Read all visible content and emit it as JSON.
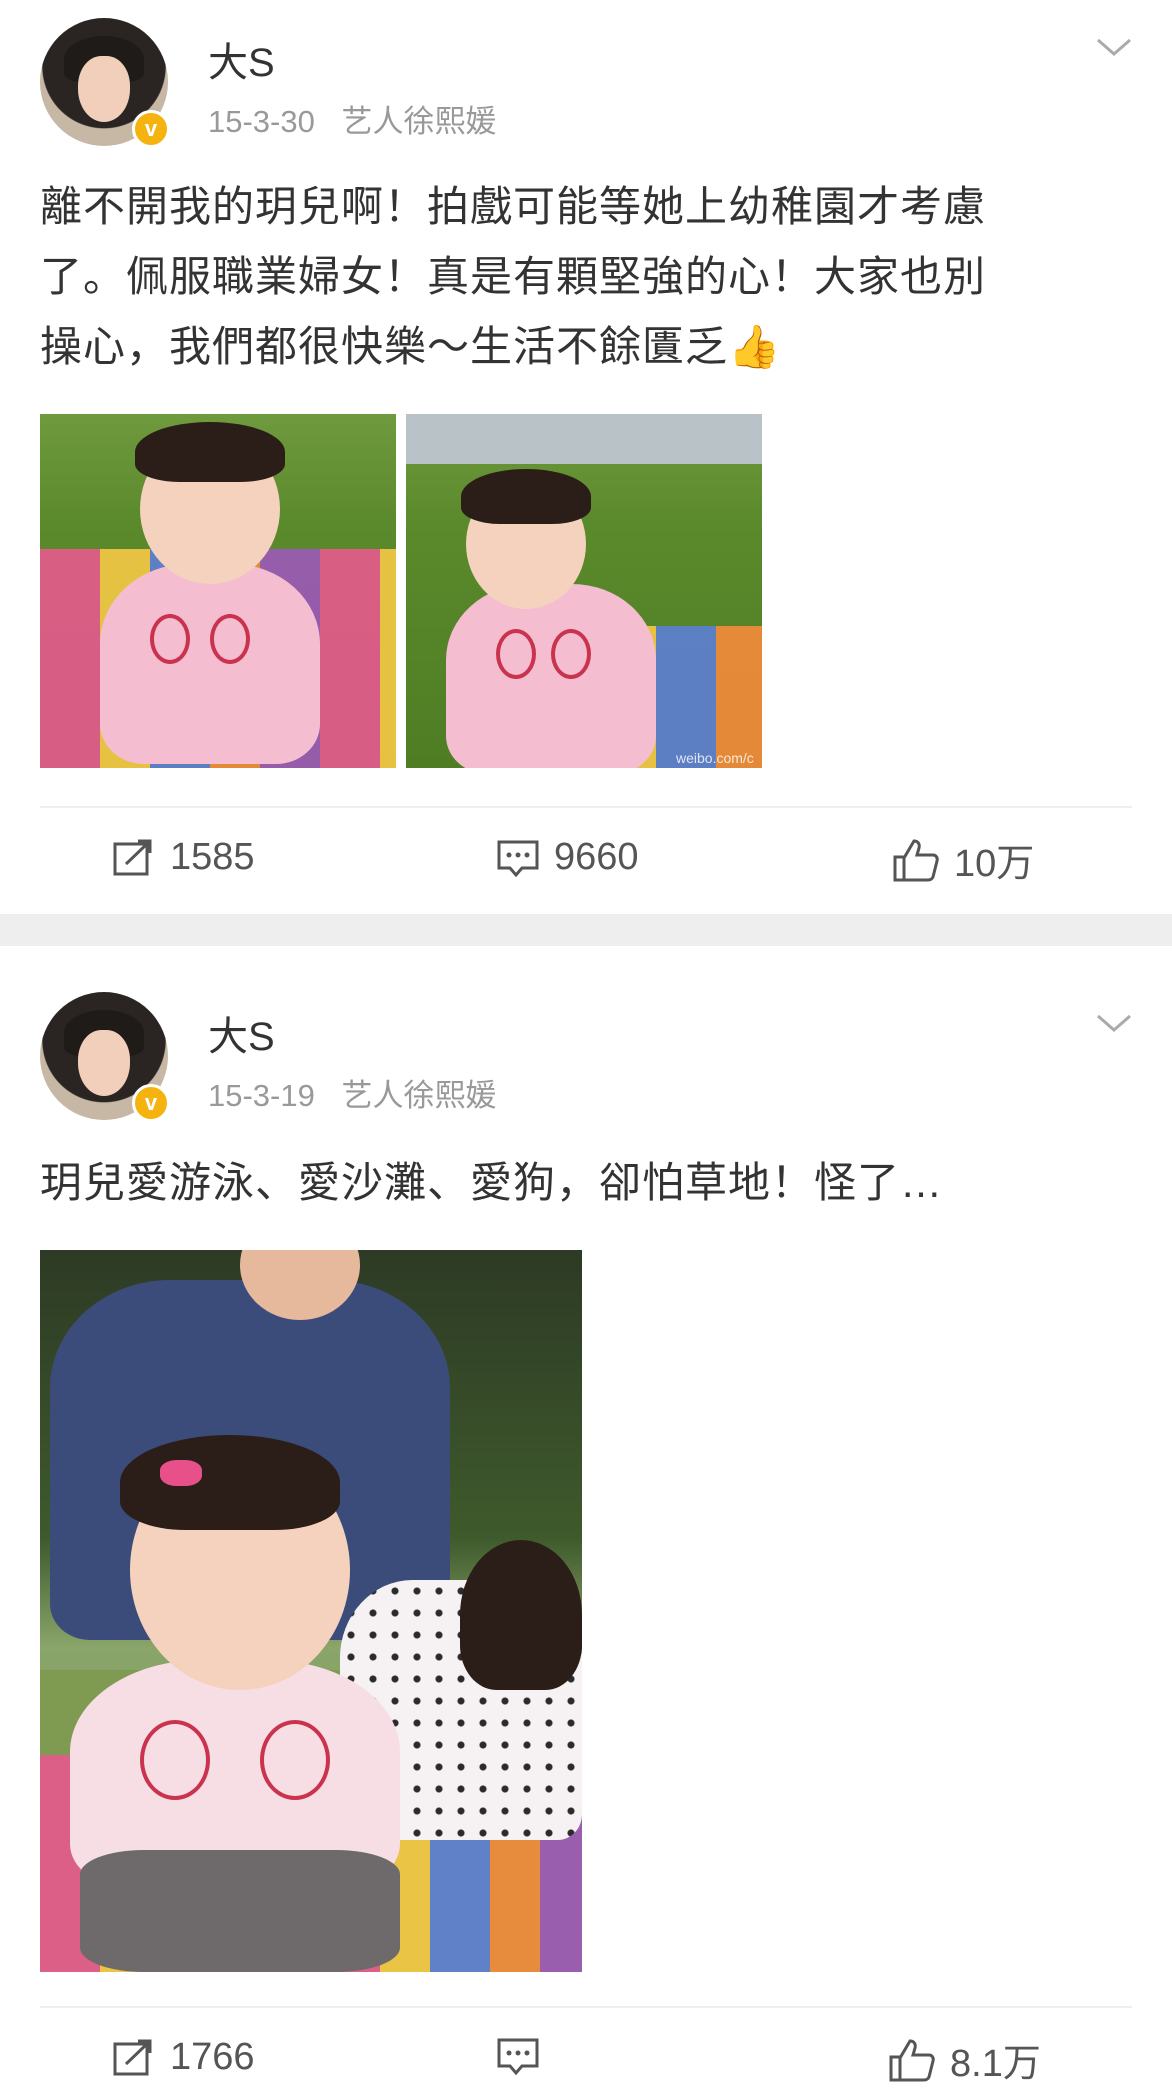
{
  "posts": [
    {
      "username": "大S",
      "date": "15-3-30",
      "source": "艺人徐熙媛",
      "text_lines": [
        "離不開我的玥兒啊！拍戲可能等她上幼稚園才考慮",
        "了。佩服職業婦女！真是有顆堅強的心！大家也別",
        "操心，我們都很快樂～生活不餘匱乏👍"
      ],
      "repost_count": "1585",
      "comment_count": "9660",
      "like_count": "10万",
      "photo_watermark": "weibo.com/c"
    },
    {
      "username": "大S",
      "date": "15-3-19",
      "source": "艺人徐熙媛",
      "text_lines": [
        "玥兒愛游泳、愛沙灘、愛狗，卻怕草地！怪了…"
      ],
      "repost_count": "1766",
      "comment_count": "",
      "like_count": "8.1万"
    }
  ],
  "icons": {
    "verified": "v-badge-icon",
    "menu": "chevron-down-icon",
    "repost": "repost-icon",
    "comment": "comment-icon",
    "like": "thumbs-up-icon"
  },
  "colors": {
    "text": "#333333",
    "meta": "#999999",
    "badge": "#f5b30f",
    "separator": "#eeeeee"
  }
}
